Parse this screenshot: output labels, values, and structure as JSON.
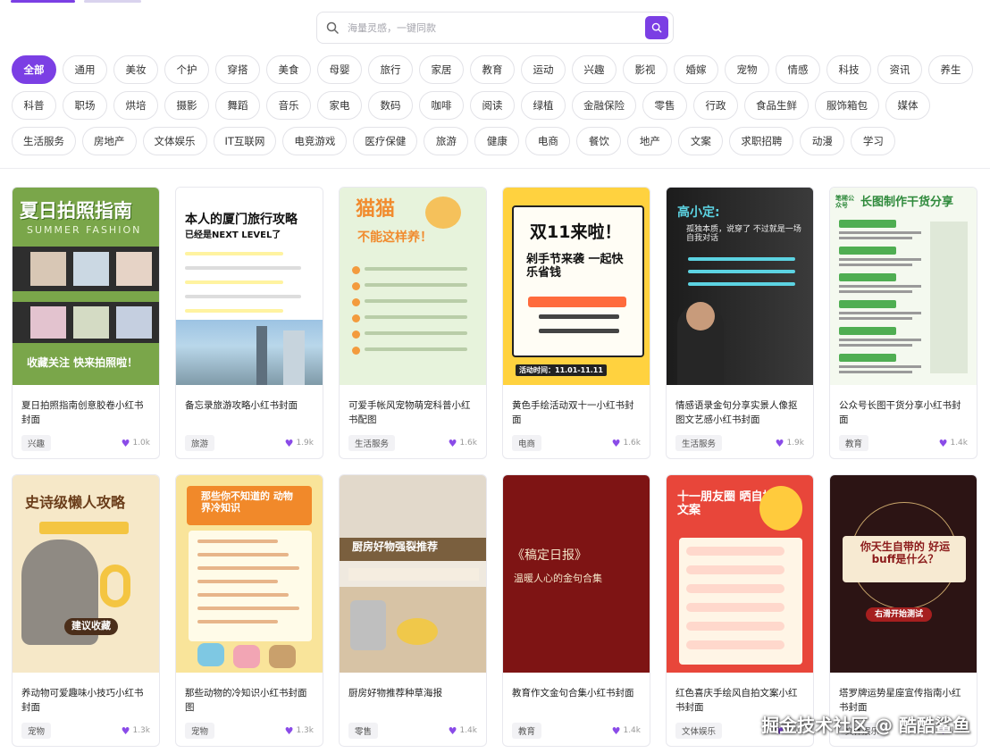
{
  "search": {
    "placeholder": "海量灵感，一键同款"
  },
  "tag_rows": [
    [
      "全部",
      "通用",
      "美妆",
      "个护",
      "穿搭",
      "美食",
      "母婴",
      "旅行",
      "家居",
      "教育",
      "运动",
      "兴趣",
      "影视",
      "婚嫁",
      "宠物",
      "情感",
      "科技",
      "资讯",
      "养生"
    ],
    [
      "科普",
      "职场",
      "烘培",
      "摄影",
      "舞蹈",
      "音乐",
      "家电",
      "数码",
      "咖啡",
      "阅读",
      "绿植",
      "金融保险",
      "零售",
      "行政",
      "食品生鲜",
      "服饰箱包",
      "媒体"
    ],
    [
      "生活服务",
      "房地产",
      "文体娱乐",
      "IT互联网",
      "电竞游戏",
      "医疗保健",
      "旅游",
      "健康",
      "电商",
      "餐饮",
      "地产",
      "文案",
      "求职招聘",
      "动漫",
      "学习"
    ]
  ],
  "active_tag": "全部",
  "cards": [
    {
      "title": "夏日拍照指南创意胶卷小红书封面",
      "tag": "兴趣",
      "likes": "1.0k",
      "thumb": {
        "bg": "#7aa64a",
        "headline": "夏日拍照指南",
        "sub": "SUMMER FASHION",
        "foot": "收藏关注 快来拍照啦！"
      }
    },
    {
      "title": "备忘录旅游攻略小红书封面",
      "tag": "旅游",
      "likes": "1.9k",
      "thumb": {
        "bg": "#ffffff",
        "headline": "本人的厦门旅行攻略",
        "sub": "已经是NEXT LEVEL了",
        "foot": ""
      }
    },
    {
      "title": "可爱手帐风宠物萌宠科普小红书配图",
      "tag": "生活服务",
      "likes": "1.6k",
      "thumb": {
        "bg": "#e7f3dc",
        "headline": "猫猫",
        "sub": "不能这样养！",
        "foot": ""
      }
    },
    {
      "title": "黄色手绘活动双十一小红书封面",
      "tag": "电商",
      "likes": "1.6k",
      "thumb": {
        "bg": "#ffd23f",
        "headline": "双11来啦！",
        "sub": "剁手节来袭 一起快乐省钱",
        "foot": "活动时间：11.01-11.11"
      }
    },
    {
      "title": "情感语录金句分享实景人像抠图文艺感小红书封面",
      "tag": "生活服务",
      "likes": "1.9k",
      "thumb": {
        "bg": "#2b2b2b",
        "headline": "高小定:",
        "sub": "孤独本质，说穿了 不过就是一场自我对话",
        "foot": ""
      }
    },
    {
      "title": "公众号长图干货分享小红书封面",
      "tag": "教育",
      "likes": "1.4k",
      "thumb": {
        "bg": "#f4f9ef",
        "headline": "长图制作干货分享",
        "sub": "笔稀公众号",
        "foot": ""
      }
    },
    {
      "title": "养动物可爱趣味小技巧小红书封面",
      "tag": "宠物",
      "likes": "1.3k",
      "thumb": {
        "bg": "#f6e8c8",
        "headline": "史诗级懒人攻略",
        "sub": "建议收藏",
        "foot": ""
      }
    },
    {
      "title": "那些动物的冷知识小红书封面图",
      "tag": "宠物",
      "likes": "1.3k",
      "thumb": {
        "bg": "#f9e49a",
        "headline": "那些你不知道的 动物界冷知识",
        "sub": "",
        "foot": ""
      }
    },
    {
      "title": "厨房好物推荐种草海报",
      "tag": "零售",
      "likes": "1.4k",
      "thumb": {
        "bg": "#efe9df",
        "headline": "厨房好物强裂推荐",
        "sub": "",
        "foot": ""
      }
    },
    {
      "title": "教育作文金句合集小红书封面",
      "tag": "教育",
      "likes": "1.4k",
      "thumb": {
        "bg": "#7e1414",
        "headline": "《稿定日报》",
        "sub": "温暖人心的金句合集",
        "foot": ""
      }
    },
    {
      "title": "红色喜庆手绘风自拍文案小红书封面",
      "tag": "文体娱乐",
      "likes": "1.6k",
      "thumb": {
        "bg": "#e8463a",
        "headline": "十一朋友圈 晒自拍文案",
        "sub": "",
        "foot": ""
      }
    },
    {
      "title": "塔罗牌运势星座宣传指南小红书封面",
      "tag": "文体娱乐",
      "likes": "1.8k",
      "thumb": {
        "bg": "#2c1414",
        "headline": "你天生自带的 好运buff是什么？",
        "sub": "右滑开始测试",
        "foot": ""
      }
    }
  ],
  "watermark": "掘金技术社区 @ 酷酷鲨鱼",
  "colors": {
    "accent": "#7b3fe4"
  }
}
